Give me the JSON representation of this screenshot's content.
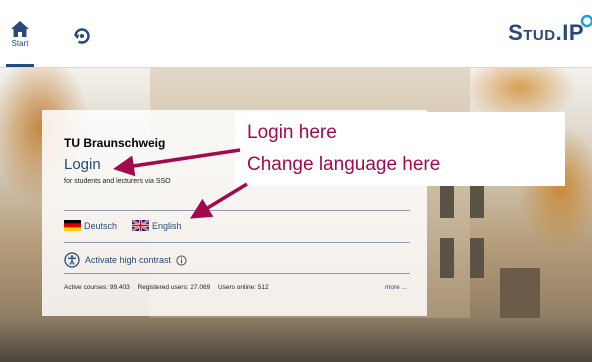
{
  "nav": {
    "start_label": "Start",
    "brand": "Stud.IP"
  },
  "login": {
    "organization": "TU Braunschweig",
    "link_label": "Login",
    "subtitle": "for students and lecturers via SSO"
  },
  "languages": [
    {
      "label": "Deutsch",
      "flag": "de-flag-icon"
    },
    {
      "label": "English",
      "flag": "uk-flag-icon"
    }
  ],
  "contrast": {
    "label": "Activate high contrast"
  },
  "stats": {
    "courses": "Active courses: 99.403",
    "users": "Registered users: 27.069",
    "online": "Users online: 512",
    "more": "more ..."
  },
  "annotation": {
    "line1": "Login here",
    "line2": "Change language here"
  },
  "colors": {
    "brand": "#28497c",
    "annotation": "#a3094d"
  }
}
